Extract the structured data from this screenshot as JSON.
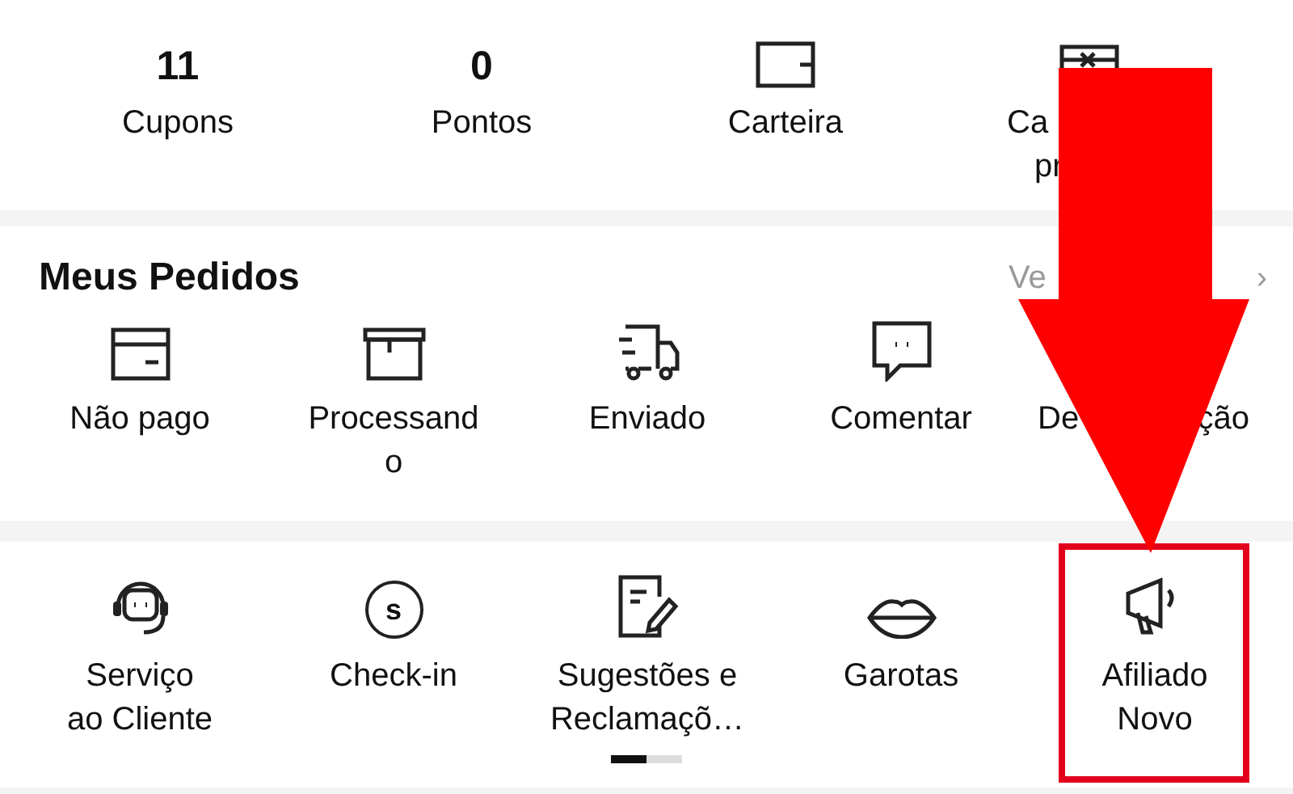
{
  "summary": [
    {
      "kind": "count",
      "value": "11",
      "lines": [
        "Cupons"
      ]
    },
    {
      "kind": "count",
      "value": "0",
      "lines": [
        "Pontos"
      ]
    },
    {
      "kind": "icon",
      "lines": [
        "Carteira"
      ]
    },
    {
      "kind": "icon",
      "lines": [
        "Ca",
        "pr"
      ]
    }
  ],
  "orders": {
    "title": "Meus Pedidos",
    "link": "Ve",
    "chevron": "›",
    "items": [
      {
        "lines": [
          "Não pago"
        ]
      },
      {
        "lines": [
          "Processand",
          "o"
        ]
      },
      {
        "lines": [
          "Enviado"
        ]
      },
      {
        "lines": [
          "Comentar"
        ]
      },
      {
        "fragments": [
          "De",
          "ção"
        ]
      }
    ]
  },
  "services": {
    "items": [
      {
        "lines": [
          "Serviço",
          "ao Cliente"
        ],
        "highlighted": false
      },
      {
        "lines": [
          "Check-in"
        ],
        "badge": "s",
        "highlighted": false
      },
      {
        "lines": [
          "Sugestões e",
          "Reclamaçõ…"
        ],
        "highlighted": false
      },
      {
        "lines": [
          "Garotas"
        ],
        "highlighted": false
      },
      {
        "lines": [
          "Afiliado",
          "Novo"
        ],
        "highlighted": true
      }
    ],
    "pager": [
      {
        "selected": true
      },
      {
        "selected": false
      }
    ]
  }
}
